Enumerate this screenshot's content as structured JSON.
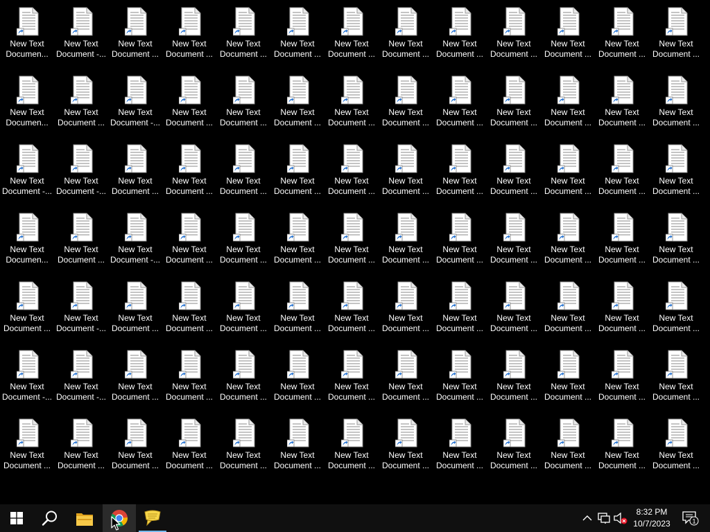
{
  "desktop": {
    "icon_line1": "New Text",
    "columns": 13,
    "rows": [
      [
        "Documen...",
        "Document -...",
        "Document ...",
        "Document ...",
        "Document ...",
        "Document ...",
        "Document ...",
        "Document ...",
        "Document ...",
        "Document ...",
        "Document ...",
        "Document ...",
        "Document ..."
      ],
      [
        "Documen...",
        "Document ...",
        "Document -...",
        "Document ...",
        "Document ...",
        "Document ...",
        "Document ...",
        "Document ...",
        "Document ...",
        "Document ...",
        "Document ...",
        "Document ...",
        "Document ..."
      ],
      [
        "Document -...",
        "Document -...",
        "Document ...",
        "Document ...",
        "Document ...",
        "Document ...",
        "Document ...",
        "Document ...",
        "Document ...",
        "Document ...",
        "Document ...",
        "Document ...",
        "Document ..."
      ],
      [
        "Documen...",
        "Document ...",
        "Document -...",
        "Document ...",
        "Document ...",
        "Document ...",
        "Document ...",
        "Document ...",
        "Document ...",
        "Document ...",
        "Document ...",
        "Document ...",
        "Document ..."
      ],
      [
        "Document ...",
        "Document -...",
        "Document ...",
        "Document ...",
        "Document ...",
        "Document ...",
        "Document ...",
        "Document ...",
        "Document ...",
        "Document ...",
        "Document ...",
        "Document ...",
        "Document ..."
      ],
      [
        "Document -...",
        "Document -...",
        "Document ...",
        "Document ...",
        "Document ...",
        "Document ...",
        "Document ...",
        "Document ...",
        "Document ...",
        "Document ...",
        "Document ...",
        "Document ...",
        "Document ..."
      ],
      [
        "Document ...",
        "Document ...",
        "Document ...",
        "Document ...",
        "Document ...",
        "Document ...",
        "Document ...",
        "Document ...",
        "Document ...",
        "Document ...",
        "Document ...",
        "Document ...",
        "Document ..."
      ]
    ],
    "icon_name": "text-document-shortcut-icon"
  },
  "taskbar": {
    "start_icon": "windows-start-icon",
    "search_icon": "search-icon",
    "pinned": [
      {
        "icon": "file-explorer-icon"
      },
      {
        "icon": "chrome-icon"
      },
      {
        "icon": "sticky-notes-icon"
      }
    ],
    "tray": {
      "chevron_icon": "chevron-up-icon",
      "network_icon": "network-icon",
      "volume_icon": "volume-muted-icon",
      "notification_icon": "notification-icon",
      "notification_count": "1"
    },
    "clock": {
      "time": "8:32 PM",
      "date": "10/7/2023"
    }
  },
  "colors": {
    "desktop_bg": "#000000",
    "taskbar_bg": "#101010",
    "accent": "#76b9ed",
    "label_text": "#ffffff"
  }
}
